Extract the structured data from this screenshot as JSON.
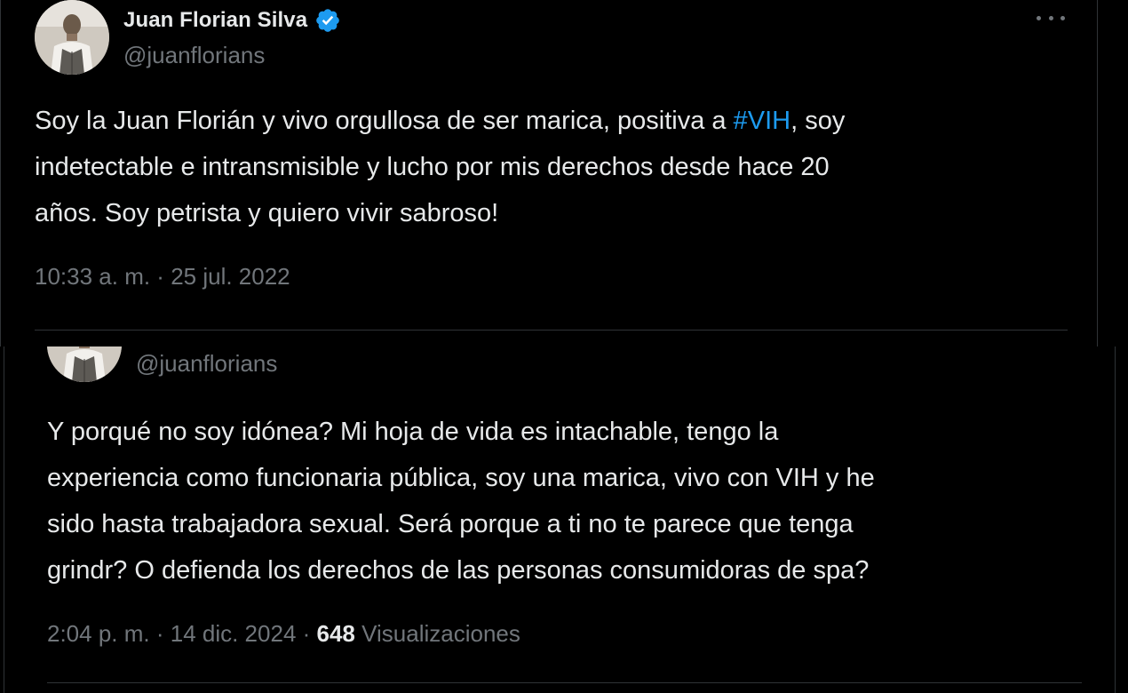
{
  "tweets": [
    {
      "display_name": "Juan Florian Silva",
      "handle": "@juanflorians",
      "verified": true,
      "text_before_hashtag": "Soy la Juan Florián y vivo orgullosa de ser marica, positiva a ",
      "hashtag": "#VIH",
      "text_after_hashtag": ", soy\nindetectable e intransmisible y lucho por mis derechos desde hace 20\naños. Soy petrista y quiero vivir sabroso!",
      "time": "10:33 a. m.",
      "date": "25 jul. 2022"
    },
    {
      "handle": "@juanflorians",
      "text": "Y porqué no soy idónea? Mi hoja de vida es intachable, tengo la\nexperiencia como funcionaria pública, soy una marica, vivo con VIH y he\nsido hasta trabajadora sexual. Será porque a ti no te parece que tenga\ngrindr? O defienda los derechos de las personas consumidoras de spa?",
      "time": "2:04 p. m.",
      "date": "14 dic. 2024",
      "views_count": "648",
      "views_label": "Visualizaciones"
    }
  ],
  "separator": " · ",
  "colors": {
    "background": "#000000",
    "text": "#e7e9ea",
    "muted": "#71767b",
    "accent": "#1d9bf0",
    "border": "#2f3336"
  },
  "icons": {
    "verified": "verified-badge-icon",
    "more": "more-options-icon"
  }
}
